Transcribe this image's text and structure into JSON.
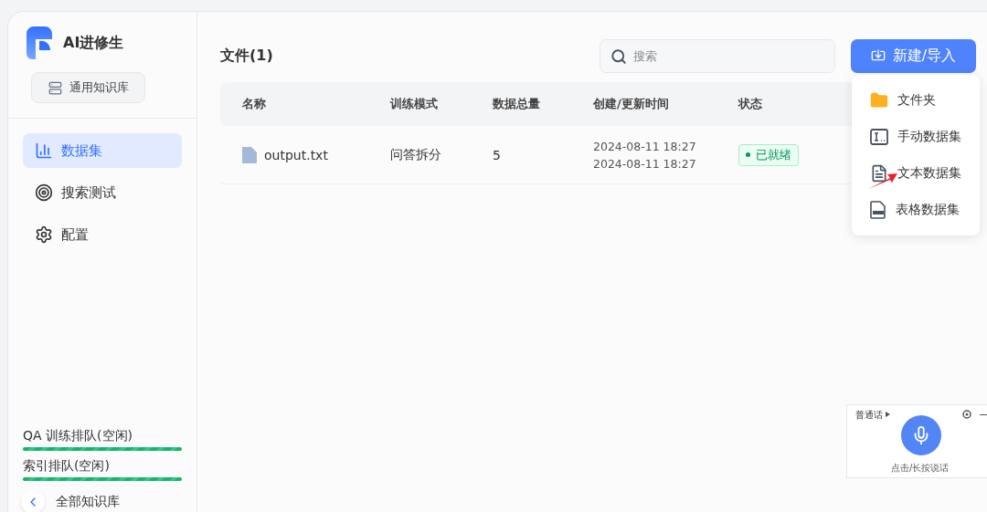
{
  "app": {
    "name": "AI进修生"
  },
  "sidebar": {
    "kb_button": "通用知识库",
    "items": [
      {
        "kind": "dataset",
        "label": "数据集",
        "selected": true
      },
      {
        "kind": "search",
        "label": "搜索测试",
        "selected": false
      },
      {
        "kind": "config",
        "label": "配置",
        "selected": false
      }
    ],
    "queues": [
      {
        "label": "QA 训练排队(空闲)",
        "level": 1
      },
      {
        "label": "索引排队(空闲)",
        "level": 1
      }
    ],
    "back": "全部知识库"
  },
  "main": {
    "title": "文件(1)",
    "search": {
      "placeholder": "搜索"
    },
    "new_button": "新建/导入",
    "table": {
      "columns": [
        "名称",
        "训练模式",
        "数据总量",
        "创建/更新时间",
        "状态"
      ],
      "rows": [
        {
          "name": "output.txt",
          "mode": "问答拆分",
          "total": "5",
          "created": "2024-08-11 18:27",
          "updated": "2024-08-11 18:27",
          "status": "已就绪"
        }
      ]
    },
    "menu": [
      {
        "kind": "folder",
        "label": "文件夹"
      },
      {
        "kind": "manual",
        "label": "手动数据集"
      },
      {
        "kind": "text",
        "label": "文本数据集"
      },
      {
        "kind": "csv",
        "label": "表格数据集"
      }
    ]
  },
  "voice": {
    "language": "普通话",
    "hint": "点击/长按说话"
  }
}
